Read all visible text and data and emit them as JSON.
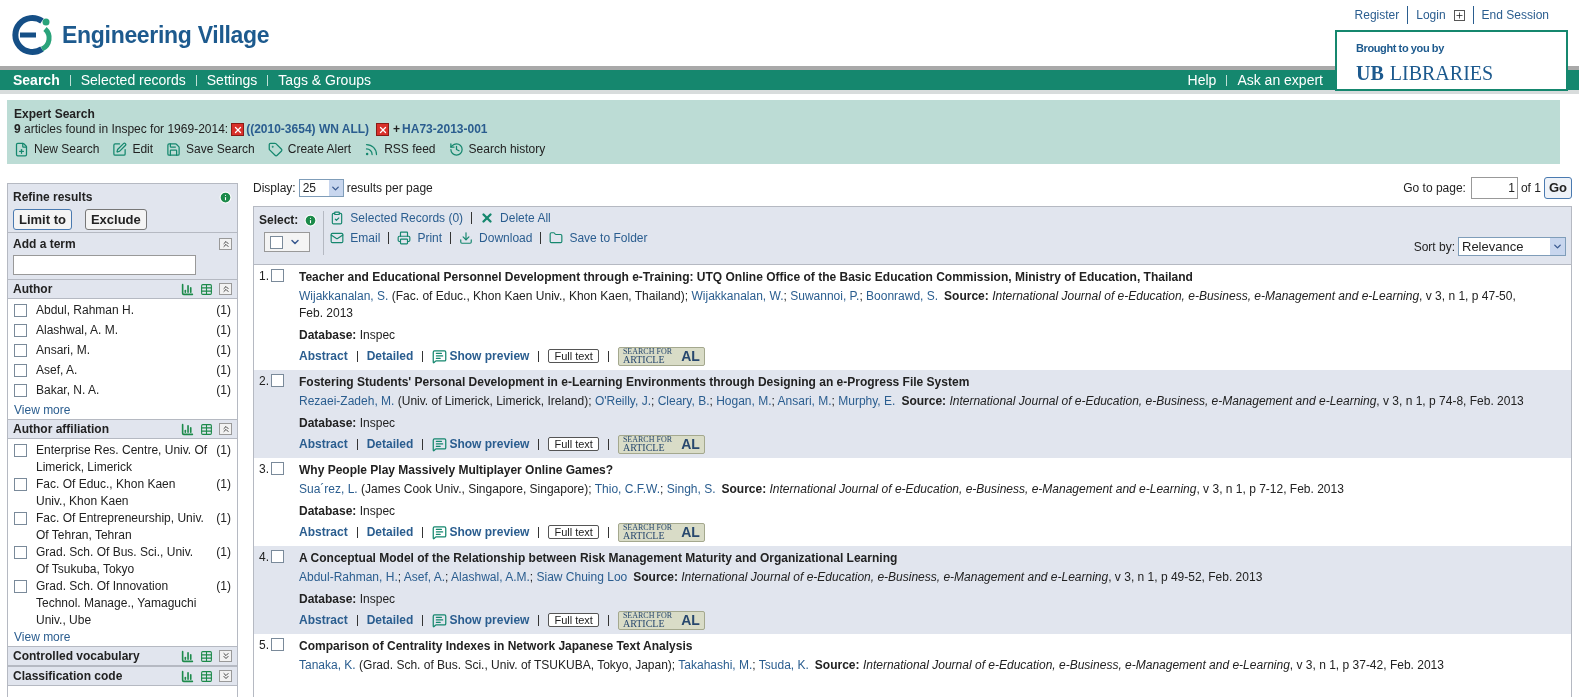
{
  "brand": {
    "name": "Engineering Village"
  },
  "top_links": [
    {
      "label": "Register"
    },
    {
      "label": "Login",
      "has_plus": true
    },
    {
      "label": "End Session"
    }
  ],
  "sponsor": {
    "caption": "Brought to you by",
    "mark": "UB",
    "name": "LIBRARIES"
  },
  "nav": {
    "left": [
      {
        "label": "Search",
        "selected": true
      },
      {
        "label": "Selected records",
        "selected": false
      },
      {
        "label": "Settings",
        "selected": false
      },
      {
        "label": "Tags & Groups",
        "selected": false
      }
    ],
    "right": [
      {
        "label": "Help"
      },
      {
        "label": "Ask an expert"
      }
    ]
  },
  "search_summary": {
    "title": "Expert Search",
    "count": "9",
    "text": "articles found in Inspec for 1969-2014:",
    "terms": [
      {
        "label": "((2010-3654) WN ALL)"
      },
      {
        "prefix": "+",
        "label": "HA73-2013-001"
      }
    ],
    "actions": [
      {
        "kind": "new",
        "label": "New Search"
      },
      {
        "kind": "edit",
        "label": "Edit"
      },
      {
        "kind": "save",
        "label": "Save Search"
      },
      {
        "kind": "alert",
        "label": "Create Alert"
      },
      {
        "kind": "rss",
        "label": "RSS feed"
      },
      {
        "kind": "history",
        "label": "Search history"
      }
    ]
  },
  "refine": {
    "title": "Refine results",
    "buttons": [
      "Limit to",
      "Exclude"
    ],
    "add_term": {
      "label": "Add a term"
    },
    "facets": [
      {
        "title": "Author",
        "expanded": true,
        "view_more": "View more",
        "items": [
          {
            "label": "Abdul, Rahman H.",
            "count": "(1)",
            "checked": false
          },
          {
            "label": "Alashwal, A. M.",
            "count": "(1)",
            "checked": false
          },
          {
            "label": "Ansari, M.",
            "count": "(1)",
            "checked": false
          },
          {
            "label": "Asef, A.",
            "count": "(1)",
            "checked": false
          },
          {
            "label": "Bakar, N. A.",
            "count": "(1)",
            "checked": false
          }
        ]
      },
      {
        "title": "Author affiliation",
        "expanded": true,
        "view_more": "View more",
        "items": [
          {
            "label": "Enterprise Res. Centre, Univ. Of Limerick, Limerick",
            "count": "(1)",
            "checked": false
          },
          {
            "label": "Fac. Of Educ., Khon Kaen Univ., Khon Kaen",
            "count": "(1)",
            "checked": false
          },
          {
            "label": "Fac. Of Entrepreneurship, Univ. Of Tehran, Tehran",
            "count": "(1)",
            "checked": false
          },
          {
            "label": "Grad. Sch. Of Bus. Sci., Univ. Of Tsukuba, Tokyo",
            "count": "(1)",
            "checked": false
          },
          {
            "label": "Grad. Sch. Of Innovation Technol. Manage., Yamaguchi Univ., Ube",
            "count": "(1)",
            "checked": false
          }
        ]
      },
      {
        "title": "Controlled vocabulary",
        "expanded": false
      },
      {
        "title": "Classification code",
        "expanded": false
      }
    ]
  },
  "display": {
    "label": "Display:",
    "value": "25",
    "suffix": "results per page"
  },
  "pager": {
    "label": "Go to page:",
    "value": "1",
    "total": "of 1",
    "button": "Go"
  },
  "toolbar": {
    "select_label": "Select:",
    "select_all_checked": false,
    "row1": [
      {
        "kind": "selected",
        "label": "Selected Records (0)"
      },
      {
        "kind": "delete",
        "label": "Delete All"
      }
    ],
    "row2": [
      {
        "kind": "email",
        "label": "Email"
      },
      {
        "kind": "print",
        "label": "Print"
      },
      {
        "kind": "download",
        "label": "Download"
      },
      {
        "kind": "folder",
        "label": "Save to Folder"
      }
    ],
    "sort_label": "Sort by:",
    "sort_value": "Relevance"
  },
  "results": [
    {
      "number": "1.",
      "checked": false,
      "title": "Teacher and Educational Personnel Development through e-Training: UTQ Online Office of the Basic Education Commission, Ministry of Education, Thailand",
      "authors": [
        {
          "name": "Wijakkanalan, S.",
          "affiliation": "(Fac. of Educ., Khon Kaen Univ., Khon Kaen, Thailand)",
          "separator": ";"
        },
        {
          "name": "Wijakkanalan, W.",
          "separator": ";"
        },
        {
          "name": "Suwannoi, P.",
          "separator": ";"
        },
        {
          "name": "Boonrawd, S."
        }
      ],
      "source_label": "Source:",
      "journal": "International Journal of e-Education, e-Business, e-Management and e-Learning",
      "details": ", v 3, n 1, p 47-50, Feb. 2013",
      "database_label": "Database:",
      "database": "Inspec",
      "actions": {
        "abstract": "Abstract",
        "detailed": "Detailed",
        "preview": "Show preview",
        "full_text": "Full text",
        "badge_top": "SEARCH FOR",
        "badge_bottom": "ARTICLE",
        "badge_mark": "AL"
      }
    },
    {
      "number": "2.",
      "checked": false,
      "title": "Fostering Students' Personal Development in e-Learning Environments through Designing an e-Progress File System",
      "authors": [
        {
          "name": "Rezaei-Zadeh, M.",
          "affiliation": "(Univ. of Limerick, Limerick, Ireland)",
          "separator": ";"
        },
        {
          "name": "O'Reilly, J.",
          "separator": ";"
        },
        {
          "name": "Cleary, B.",
          "separator": ";"
        },
        {
          "name": "Hogan, M.",
          "separator": ";"
        },
        {
          "name": "Ansari, M.",
          "separator": ";"
        },
        {
          "name": "Murphy, E."
        }
      ],
      "source_label": "Source:",
      "journal": "International Journal of e-Education, e-Business, e-Management and e-Learning",
      "details": ", v 3, n 1, p 74-8, Feb. 2013",
      "database_label": "Database:",
      "database": "Inspec",
      "actions": {
        "abstract": "Abstract",
        "detailed": "Detailed",
        "preview": "Show preview",
        "full_text": "Full text",
        "badge_top": "SEARCH FOR",
        "badge_bottom": "ARTICLE",
        "badge_mark": "AL"
      }
    },
    {
      "number": "3.",
      "checked": false,
      "title": "Why People Play Massively Multiplayer Online Games?",
      "authors": [
        {
          "name": "Sua´rez, L.",
          "affiliation": "(James Cook Univ., Singapore, Singapore)",
          "separator": ";"
        },
        {
          "name": "Thio, C.F.W.",
          "separator": ";"
        },
        {
          "name": "Singh, S."
        }
      ],
      "source_label": "Source:",
      "journal": "International Journal of e-Education, e-Business, e-Management and e-Learning",
      "details": ", v 3, n 1, p 7-12, Feb. 2013",
      "database_label": "Database:",
      "database": "Inspec",
      "actions": {
        "abstract": "Abstract",
        "detailed": "Detailed",
        "preview": "Show preview",
        "full_text": "Full text",
        "badge_top": "SEARCH FOR",
        "badge_bottom": "ARTICLE",
        "badge_mark": "AL"
      }
    },
    {
      "number": "4.",
      "checked": false,
      "title": "A Conceptual Model of the Relationship between Risk Management Maturity and Organizational Learning",
      "authors": [
        {
          "name": "Abdul-Rahman, H.",
          "separator": ";"
        },
        {
          "name": "Asef, A.",
          "separator": ";"
        },
        {
          "name": "Alashwal, A.M.",
          "separator": ";"
        },
        {
          "name": "Siaw Chuing Loo"
        }
      ],
      "source_label": "Source:",
      "journal": "International Journal of e-Education, e-Business, e-Management and e-Learning",
      "details": ", v 3, n 1, p 49-52, Feb. 2013",
      "database_label": "Database:",
      "database": "Inspec",
      "actions": {
        "abstract": "Abstract",
        "detailed": "Detailed",
        "preview": "Show preview",
        "full_text": "Full text",
        "badge_top": "SEARCH FOR",
        "badge_bottom": "ARTICLE",
        "badge_mark": "AL"
      }
    },
    {
      "number": "5.",
      "checked": false,
      "title": "Comparison of Centrality Indexes in Network Japanese Text Analysis",
      "authors": [
        {
          "name": "Tanaka, K.",
          "affiliation": "(Grad. Sch. of Bus. Sci., Univ. of TSUKUBA, Tokyo, Japan)",
          "separator": ";"
        },
        {
          "name": "Takahashi, M.",
          "separator": ";"
        },
        {
          "name": "Tsuda, K."
        }
      ],
      "source_label": "Source:",
      "journal": "International Journal of e-Education, e-Business, e-Management and e-Learning",
      "details": ", v 3, n 1, p 37-42, Feb. 2013"
    }
  ]
}
